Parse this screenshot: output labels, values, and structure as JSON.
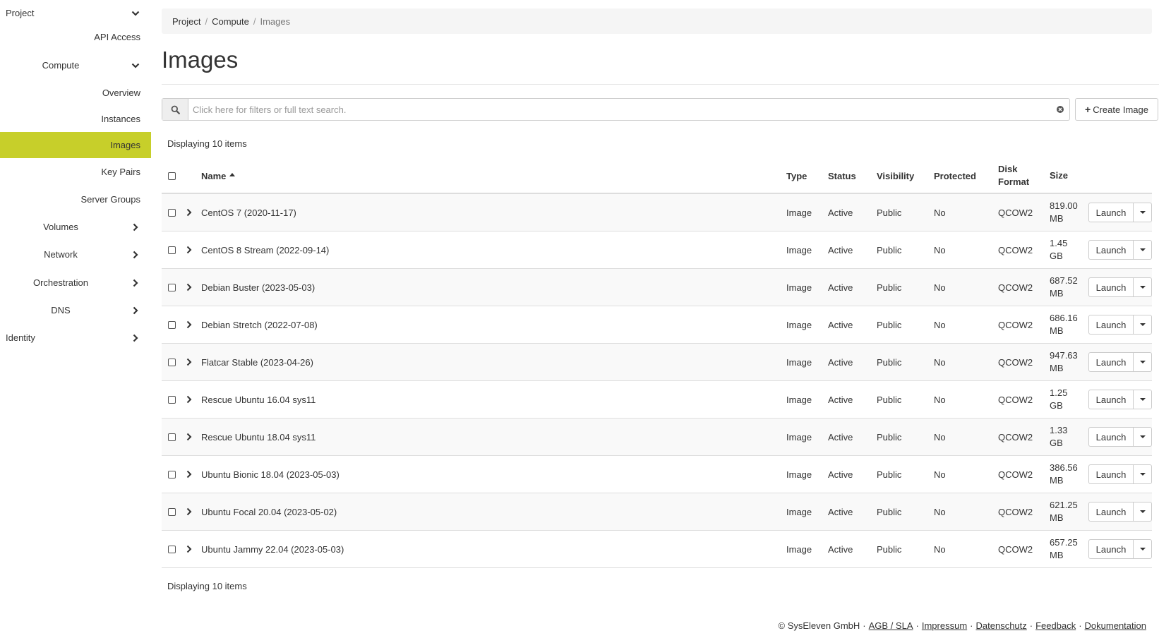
{
  "sidebar": {
    "project": "Project",
    "api_access": "API Access",
    "compute": "Compute",
    "overview": "Overview",
    "instances": "Instances",
    "images": "Images",
    "key_pairs": "Key Pairs",
    "server_groups": "Server Groups",
    "volumes": "Volumes",
    "network": "Network",
    "orchestration": "Orchestration",
    "dns": "DNS",
    "identity": "Identity",
    "active_color": "#c7cf2a"
  },
  "breadcrumb": {
    "items": [
      "Project",
      "Compute"
    ],
    "current": "Images",
    "separator": "/"
  },
  "page_title": "Images",
  "search": {
    "placeholder": "Click here for filters or full text search.",
    "value": ""
  },
  "create_button": "Create Image",
  "count_text": "Displaying 10 items",
  "table": {
    "headers": {
      "name": "Name",
      "type": "Type",
      "status": "Status",
      "visibility": "Visibility",
      "protected": "Protected",
      "disk_format_1": "Disk",
      "disk_format_2": "Format",
      "size": "Size"
    },
    "launch_label": "Launch",
    "rows": [
      {
        "name": "CentOS 7 (2020-11-17)",
        "type": "Image",
        "status": "Active",
        "visibility": "Public",
        "protected": "No",
        "format": "QCOW2",
        "size_num": "819.00",
        "size_unit": "MB"
      },
      {
        "name": "CentOS 8 Stream (2022-09-14)",
        "type": "Image",
        "status": "Active",
        "visibility": "Public",
        "protected": "No",
        "format": "QCOW2",
        "size_num": "1.45",
        "size_unit": "GB"
      },
      {
        "name": "Debian Buster (2023-05-03)",
        "type": "Image",
        "status": "Active",
        "visibility": "Public",
        "protected": "No",
        "format": "QCOW2",
        "size_num": "687.52",
        "size_unit": "MB"
      },
      {
        "name": "Debian Stretch (2022-07-08)",
        "type": "Image",
        "status": "Active",
        "visibility": "Public",
        "protected": "No",
        "format": "QCOW2",
        "size_num": "686.16",
        "size_unit": "MB"
      },
      {
        "name": "Flatcar Stable (2023-04-26)",
        "type": "Image",
        "status": "Active",
        "visibility": "Public",
        "protected": "No",
        "format": "QCOW2",
        "size_num": "947.63",
        "size_unit": "MB"
      },
      {
        "name": "Rescue Ubuntu 16.04 sys11",
        "type": "Image",
        "status": "Active",
        "visibility": "Public",
        "protected": "No",
        "format": "QCOW2",
        "size_num": "1.25",
        "size_unit": "GB"
      },
      {
        "name": "Rescue Ubuntu 18.04 sys11",
        "type": "Image",
        "status": "Active",
        "visibility": "Public",
        "protected": "No",
        "format": "QCOW2",
        "size_num": "1.33",
        "size_unit": "GB"
      },
      {
        "name": "Ubuntu Bionic 18.04 (2023-05-03)",
        "type": "Image",
        "status": "Active",
        "visibility": "Public",
        "protected": "No",
        "format": "QCOW2",
        "size_num": "386.56",
        "size_unit": "MB"
      },
      {
        "name": "Ubuntu Focal 20.04 (2023-05-02)",
        "type": "Image",
        "status": "Active",
        "visibility": "Public",
        "protected": "No",
        "format": "QCOW2",
        "size_num": "621.25",
        "size_unit": "MB"
      },
      {
        "name": "Ubuntu Jammy 22.04 (2023-05-03)",
        "type": "Image",
        "status": "Active",
        "visibility": "Public",
        "protected": "No",
        "format": "QCOW2",
        "size_num": "657.25",
        "size_unit": "MB"
      }
    ]
  },
  "footer": {
    "copyright": "© SysEleven GmbH",
    "links": [
      "AGB / SLA",
      "Impressum",
      "Datenschutz",
      "Feedback",
      "Dokumentation"
    ],
    "separator": "·"
  }
}
